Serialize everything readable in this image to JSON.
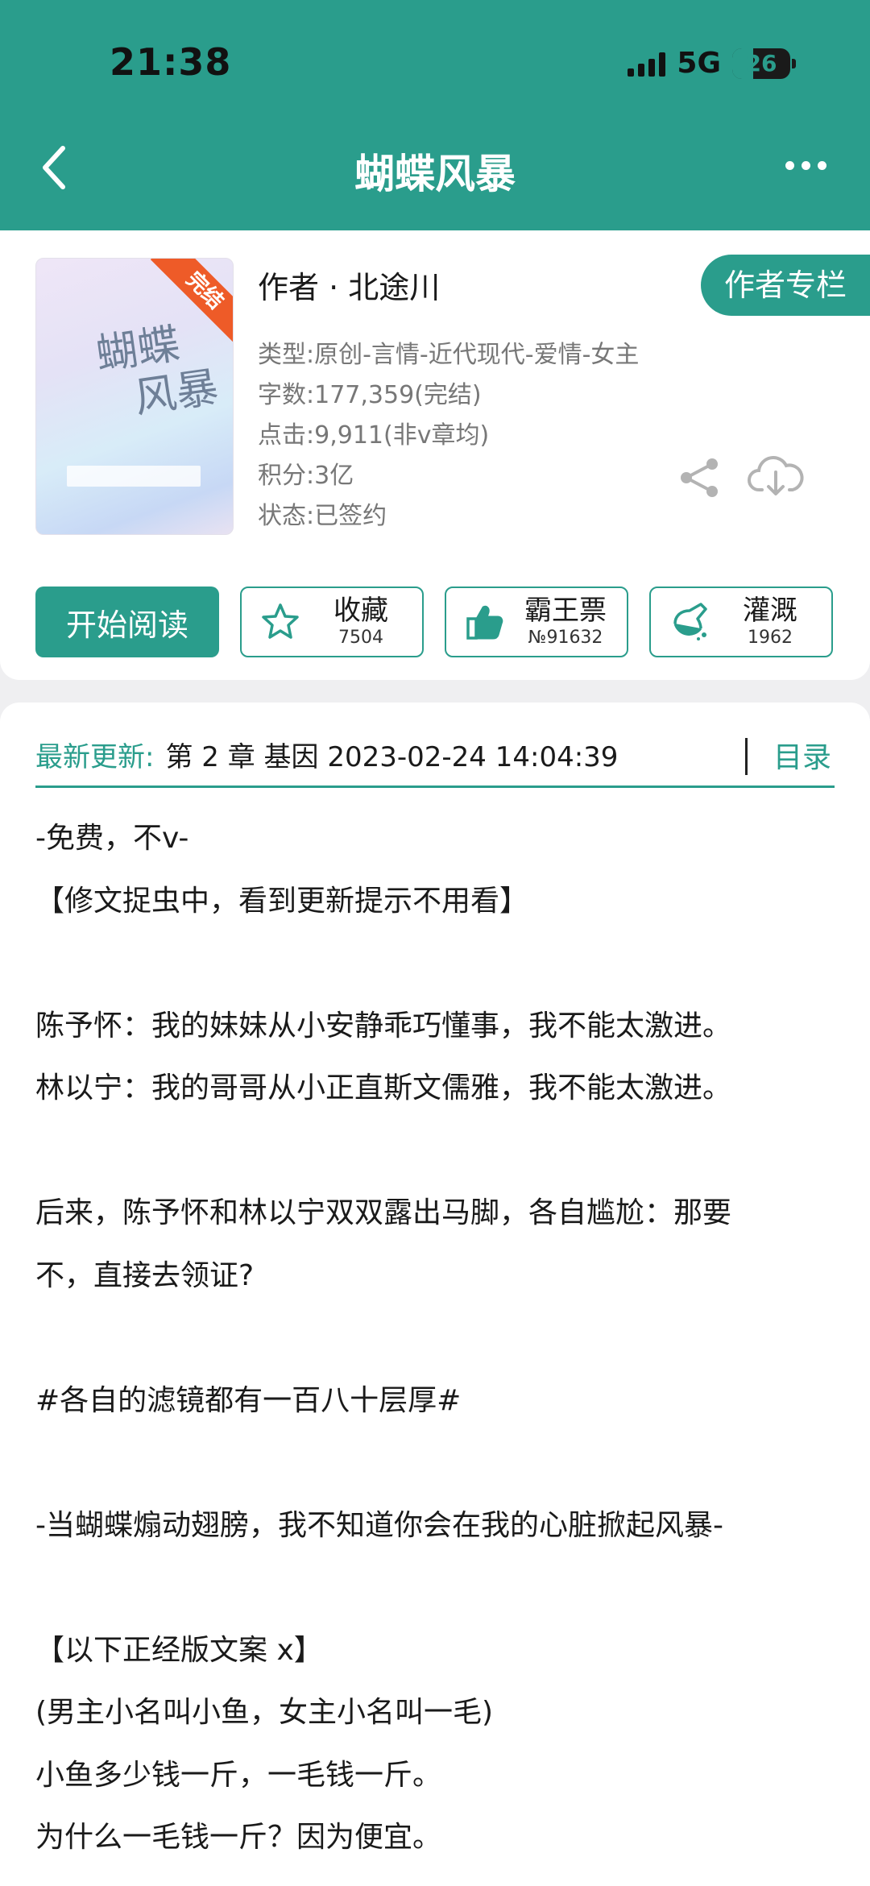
{
  "status_bar": {
    "time": "21:38",
    "network": "5G",
    "battery": "26"
  },
  "header": {
    "title": "蝴蝶风暴",
    "back_icon": "chevron-left-icon",
    "more_icon": "ellipsis-icon"
  },
  "book": {
    "cover_title": [
      "蝴蝶",
      "风暴"
    ],
    "badge": "完结",
    "author_line": "作者 · 北途川",
    "author_column_label": "作者专栏",
    "meta": [
      "类型:原创-言情-近代现代-爱情-女主",
      "字数:177,359(完结)",
      "点击:9,911(非v章均)",
      "积分:3亿",
      "状态:已签约"
    ]
  },
  "actions": {
    "read_label": "开始阅读",
    "favorite": {
      "label": "收藏",
      "count": "7504"
    },
    "ticket": {
      "label": "霸王票",
      "count": "№91632"
    },
    "water": {
      "label": "灌溉",
      "count": "1962"
    }
  },
  "latest": {
    "label": "最新更新:",
    "value": "第 2 章 基因 2023-02-24 14:04:39",
    "toc_label": "目录"
  },
  "description": [
    "-免费，不v-",
    "【修文捉虫中，看到更新提示不用看】",
    "",
    "陈予怀：我的妹妹从小安静乖巧懂事，我不能太激进。",
    "林以宁：我的哥哥从小正直斯文儒雅，我不能太激进。",
    "",
    "后来，陈予怀和林以宁双双露出马脚，各自尴尬：那要",
    "不，直接去领证?",
    "",
    "#各自的滤镜都有一百八十层厚#",
    "",
    "-当蝴蝶煽动翅膀，我不知道你会在我的心脏掀起风暴-",
    "",
    "【以下正经版文案 x】",
    "(男主小名叫小鱼，女主小名叫一毛)",
    "小鱼多少钱一斤，一毛钱一斤。",
    "为什么一毛钱一斤？因为便宜。"
  ],
  "colors": {
    "accent": "#2a9d8c",
    "badge": "#ee5b28"
  }
}
